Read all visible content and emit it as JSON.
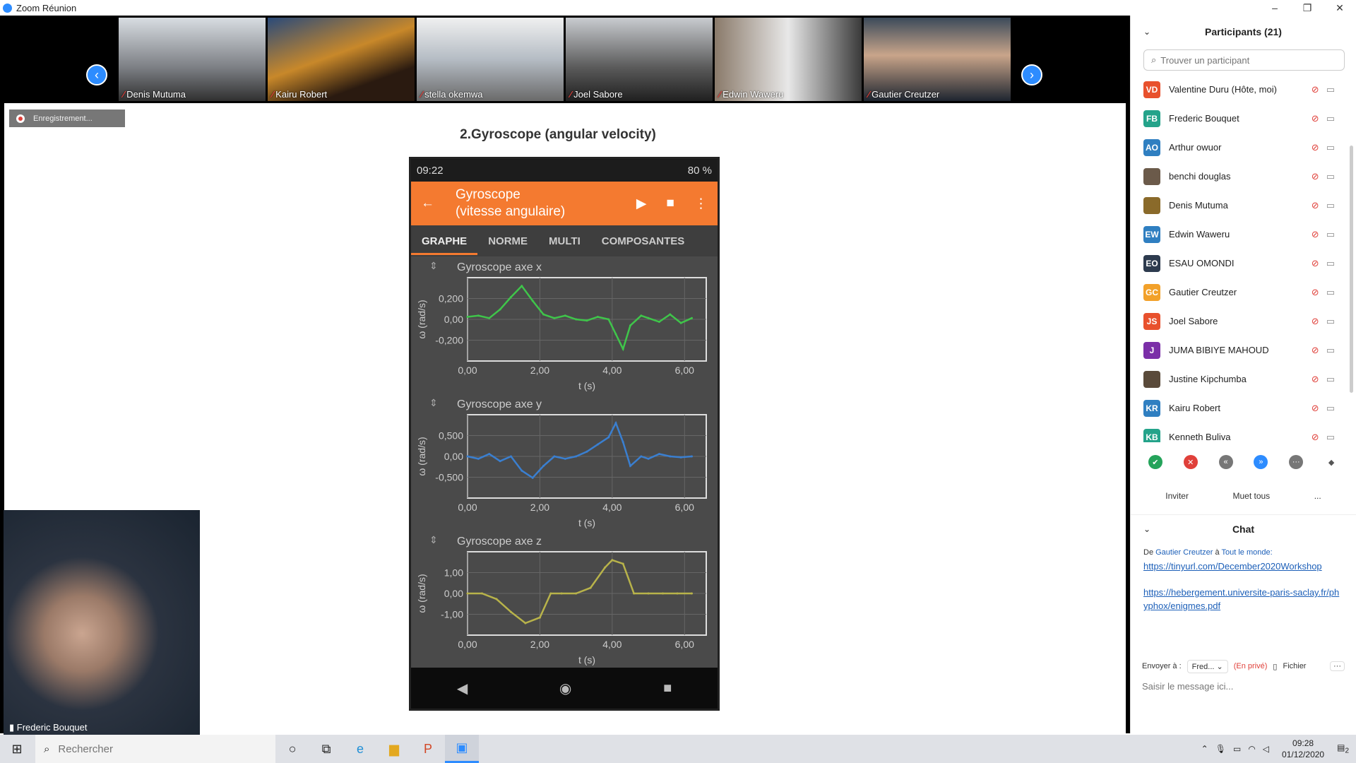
{
  "window": {
    "title": "Zoom Réunion"
  },
  "gallery": {
    "tiles": [
      {
        "name": "Denis Mutuma"
      },
      {
        "name": "Kairu Robert"
      },
      {
        "name": "stella okemwa"
      },
      {
        "name": "Joel Sabore"
      },
      {
        "name": "Edwin Waweru"
      },
      {
        "name": "Gautier Creutzer"
      }
    ]
  },
  "recording": {
    "label": "Enregistrement..."
  },
  "slide": {
    "title": "2.Gyroscope (angular velocity)"
  },
  "phone": {
    "time": "09:22",
    "battery": "80 %",
    "app_title_line1": "Gyroscope",
    "app_title_line2": "(vitesse angulaire)",
    "tabs": [
      "GRAPHE",
      "NORME",
      "MULTI",
      "COMPOSANTES"
    ]
  },
  "chart_data": [
    {
      "type": "line",
      "title": "Gyroscope axe x",
      "xlabel": "t (s)",
      "ylabel": "ω (rad/s)",
      "xticks": [
        "0,00",
        "2,00",
        "4,00",
        "6,00"
      ],
      "yticks": [
        "0,200",
        "0,00",
        "-0,200"
      ],
      "color": "#3fc54a",
      "x": [
        0,
        0.3,
        0.6,
        0.9,
        1.2,
        1.5,
        1.8,
        2.1,
        2.4,
        2.7,
        3.0,
        3.3,
        3.6,
        3.9,
        4.1,
        4.3,
        4.5,
        4.8,
        5.0,
        5.3,
        5.6,
        5.9,
        6.2
      ],
      "y": [
        0.02,
        0.03,
        0.01,
        0.08,
        0.18,
        0.27,
        0.15,
        0.04,
        0.01,
        0.03,
        0.0,
        -0.01,
        0.02,
        0.0,
        -0.12,
        -0.24,
        -0.05,
        0.03,
        0.01,
        -0.02,
        0.04,
        -0.03,
        0.01
      ]
    },
    {
      "type": "line",
      "title": "Gyroscope axe y",
      "xlabel": "t (s)",
      "ylabel": "ω (rad/s)",
      "xticks": [
        "0,00",
        "2,00",
        "4,00",
        "6,00"
      ],
      "yticks": [
        "0,500",
        "0,00",
        "-0,500"
      ],
      "color": "#3a7fd0",
      "x": [
        0,
        0.3,
        0.6,
        0.9,
        1.2,
        1.5,
        1.8,
        2.1,
        2.4,
        2.7,
        3.0,
        3.3,
        3.6,
        3.9,
        4.1,
        4.3,
        4.5,
        4.8,
        5.0,
        5.3,
        5.6,
        5.9,
        6.2
      ],
      "y": [
        0.0,
        -0.05,
        0.05,
        -0.1,
        0.0,
        -0.3,
        -0.45,
        -0.2,
        0.0,
        -0.05,
        0.0,
        0.1,
        0.25,
        0.4,
        0.7,
        0.3,
        -0.2,
        0.0,
        -0.05,
        0.05,
        0.0,
        -0.02,
        0.0
      ]
    },
    {
      "type": "line",
      "title": "Gyroscope axe z",
      "xlabel": "t (s)",
      "ylabel": "ω (rad/s)",
      "xticks": [
        "0,00",
        "2,00",
        "4,00",
        "6,00"
      ],
      "yticks": [
        "1,00",
        "0,00",
        "-1,00"
      ],
      "color": "#b8b34a",
      "x": [
        0,
        0.4,
        0.8,
        1.2,
        1.6,
        2.0,
        2.3,
        2.6,
        3.0,
        3.4,
        3.8,
        4.0,
        4.3,
        4.6,
        5.0,
        5.4,
        5.8,
        6.2
      ],
      "y": [
        0.0,
        0.0,
        -0.3,
        -1.0,
        -1.6,
        -1.3,
        0.0,
        0.0,
        0.0,
        0.3,
        1.4,
        1.8,
        1.6,
        0.0,
        0.0,
        0.0,
        0.0,
        0.0
      ]
    }
  ],
  "selfview": {
    "name": "Frederic Bouquet"
  },
  "participants": {
    "header": "Participants (21)",
    "search_placeholder": "Trouver un participant",
    "list": [
      {
        "initials": "VD",
        "name": "Valentine Duru (Hôte, moi)",
        "color": "#e8512d"
      },
      {
        "initials": "FB",
        "name": "Frederic Bouquet",
        "color": "#24a38a"
      },
      {
        "initials": "AO",
        "name": "Arthur owuor",
        "color": "#2f7fc1"
      },
      {
        "initials": "",
        "name": "benchi douglas",
        "color": "#6b5a4a"
      },
      {
        "initials": "",
        "name": "Denis Mutuma",
        "color": "#8a6a2a"
      },
      {
        "initials": "EW",
        "name": "Edwin Waweru",
        "color": "#2f7fc1"
      },
      {
        "initials": "EO",
        "name": "ESAU OMONDI",
        "color": "#2d3b4e"
      },
      {
        "initials": "GC",
        "name": "Gautier Creutzer",
        "color": "#f2a12a"
      },
      {
        "initials": "JS",
        "name": "Joel Sabore",
        "color": "#e8512d"
      },
      {
        "initials": "J",
        "name": "JUMA BIBIYE MAHOUD",
        "color": "#7b2fa8"
      },
      {
        "initials": "",
        "name": "Justine Kipchumba",
        "color": "#5a4a3a"
      },
      {
        "initials": "KR",
        "name": "Kairu Robert",
        "color": "#2f7fc1"
      },
      {
        "initials": "KB",
        "name": "Kenneth Buliva",
        "color": "#24a38a"
      }
    ],
    "invite_label": "Inviter",
    "mute_all_label": "Muet tous",
    "more_label": "..."
  },
  "chat": {
    "header": "Chat",
    "from_prefix": "De",
    "from_name": "Gautier Creutzer",
    "to_text": "à",
    "to_target": "Tout le monde:",
    "link1": "https://tinyurl.com/December2020Workshop",
    "link2": "https://hebergement.universite-paris-saclay.fr/phyphox/enigmes.pdf",
    "send_to_label": "Envoyer à :",
    "send_to_value": "Fred...",
    "private_label": "(En privé)",
    "file_label": "Fichier",
    "more_label": "···",
    "input_placeholder": "Saisir le message ici..."
  },
  "taskbar": {
    "search_placeholder": "Rechercher",
    "time": "09:28",
    "date": "01/12/2020",
    "notif_count": "2"
  }
}
